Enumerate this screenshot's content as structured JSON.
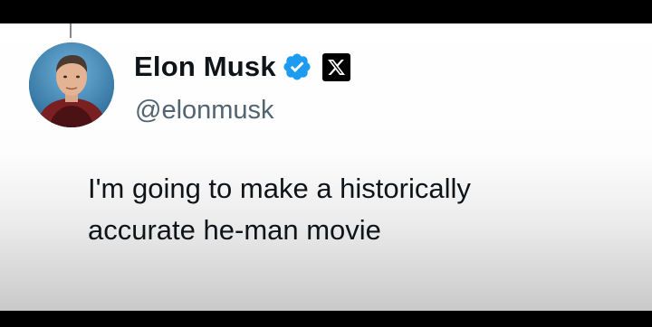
{
  "tweet": {
    "author": {
      "display_name": "Elon Musk",
      "handle": "@elonmusk",
      "verified": true,
      "verified_badge_icon": "verified-badge-icon",
      "platform_icon": "x-logo-icon",
      "avatar_icon": "profile-avatar"
    },
    "text_lines": [
      "I'm going to make a historically",
      "accurate he-man movie"
    ]
  },
  "colors": {
    "frame": "#000000",
    "card_background": "#ffffff",
    "name_text": "#0f1419",
    "handle_text": "#536471",
    "verified_blue": "#1d9bf0"
  }
}
